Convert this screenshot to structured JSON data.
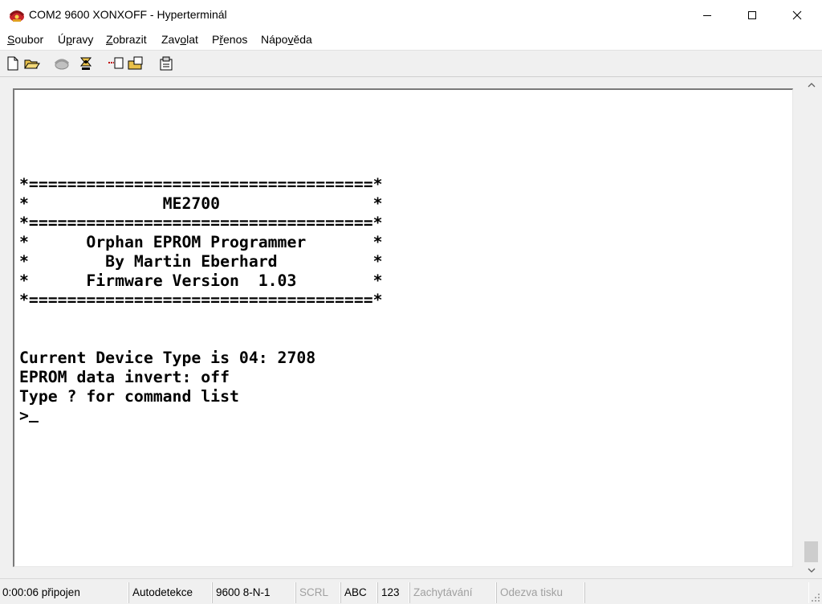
{
  "window": {
    "title": "COM2 9600 XONXOFF - Hyperterminál",
    "app_icon": "hyperterminal-phone-icon"
  },
  "menu": [
    {
      "label": "Soubor",
      "mnemonic": "S"
    },
    {
      "label": "Úpravy",
      "mnemonic": "p"
    },
    {
      "label": "Zobrazit",
      "mnemonic": "Z"
    },
    {
      "label": "Zavolat",
      "mnemonic": "o"
    },
    {
      "label": "Přenos",
      "mnemonic": "ř"
    },
    {
      "label": "Nápověda",
      "mnemonic": "v"
    }
  ],
  "toolbar": [
    {
      "icon": "new-file-icon"
    },
    {
      "icon": "open-folder-icon"
    },
    {
      "icon": "call-icon"
    },
    {
      "icon": "disconnect-icon"
    },
    {
      "icon": "send-icon"
    },
    {
      "icon": "receive-icon"
    },
    {
      "icon": "properties-icon"
    }
  ],
  "terminal": {
    "lines": [
      "",
      "",
      "*====================================*",
      "*              ME2700                *",
      "*====================================*",
      "*      Orphan EPROM Programmer       *",
      "*        By Martin Eberhard          *",
      "*      Firmware Version  1.03        *",
      "*====================================*",
      "",
      "",
      "Current Device Type is 04: 2708",
      "EPROM data invert: off",
      "Type ? for command list"
    ],
    "prompt": ">"
  },
  "status": {
    "connection": "0:00:06 připojen",
    "detect": "Autodetekce",
    "port_settings": "9600 8-N-1",
    "scrl": "SCRL",
    "abc": "ABC",
    "num": "123",
    "capture": "Zachytávání",
    "print_echo": "Odezva tisku"
  },
  "colors": {
    "chrome": "#f0f0f0",
    "terminal_bg": "#ffffff",
    "terminal_fg": "#000000",
    "disabled_text": "#a0a0a0"
  }
}
